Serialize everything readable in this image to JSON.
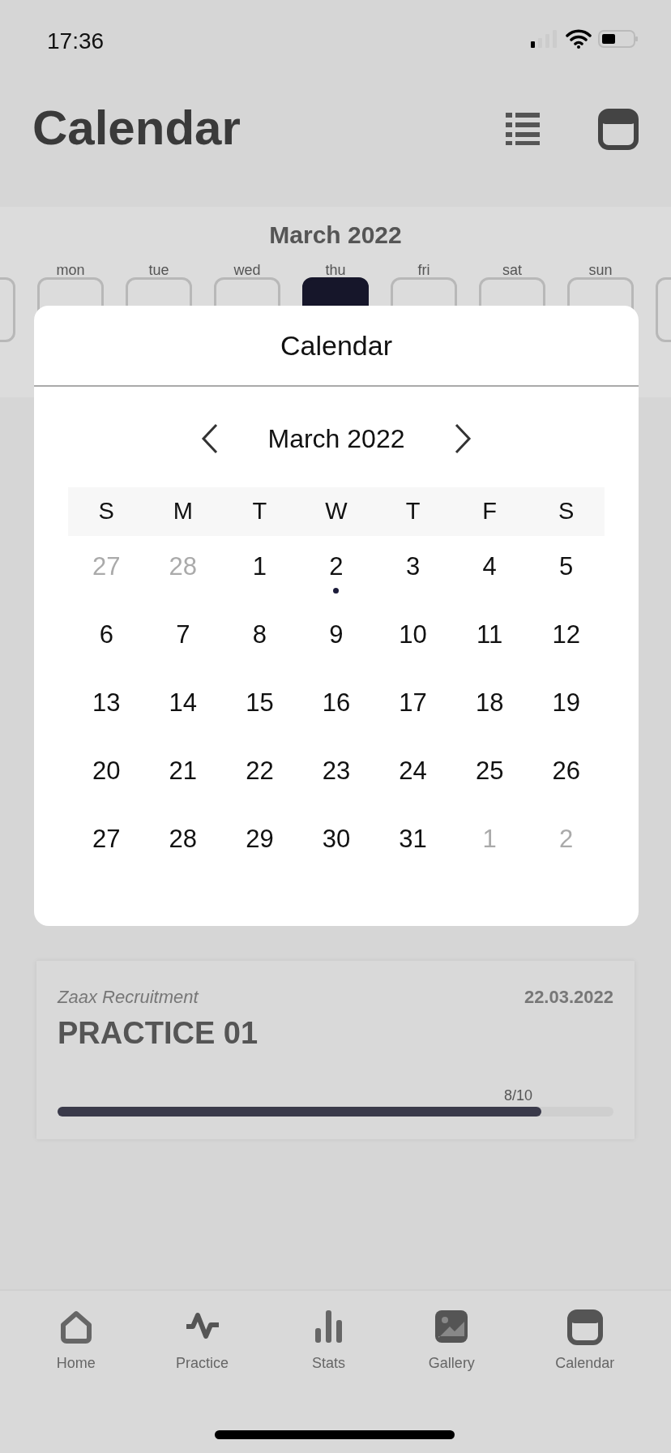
{
  "status_bar": {
    "time": "17:36"
  },
  "background": {
    "title": "Calendar",
    "month": "March 2022",
    "week_days": [
      {
        "label": "mon",
        "selected": false
      },
      {
        "label": "tue",
        "selected": false
      },
      {
        "label": "wed",
        "selected": false
      },
      {
        "label": "thu",
        "selected": true
      },
      {
        "label": "fri",
        "selected": false
      },
      {
        "label": "sat",
        "selected": false
      },
      {
        "label": "sun",
        "selected": false
      }
    ],
    "card": {
      "organizer": "Zaax Recruitment",
      "date": "22.03.2022",
      "title": "PRACTICE 01",
      "progress_text": "8/10",
      "level": 0.87
    },
    "tabs": [
      {
        "label": "Home",
        "kind": "home"
      },
      {
        "label": "Practice",
        "kind": "practice"
      },
      {
        "label": "Stats",
        "kind": "stats"
      },
      {
        "label": "Gallery",
        "kind": "gallery"
      },
      {
        "label": "Calendar",
        "kind": "calendar"
      }
    ]
  },
  "modal": {
    "title": "Calendar",
    "month": "March 2022",
    "weekdays": [
      "S",
      "M",
      "T",
      "W",
      "T",
      "F",
      "S"
    ],
    "days": [
      {
        "label": "27",
        "outside_month": true,
        "has_event": false
      },
      {
        "label": "28",
        "outside_month": true,
        "has_event": false
      },
      {
        "label": "1",
        "outside_month": false,
        "has_event": false
      },
      {
        "label": "2",
        "outside_month": false,
        "has_event": true
      },
      {
        "label": "3",
        "outside_month": false,
        "has_event": false
      },
      {
        "label": "4",
        "outside_month": false,
        "has_event": false
      },
      {
        "label": "5",
        "outside_month": false,
        "has_event": false
      },
      {
        "label": "6",
        "outside_month": false,
        "has_event": false
      },
      {
        "label": "7",
        "outside_month": false,
        "has_event": false
      },
      {
        "label": "8",
        "outside_month": false,
        "has_event": false
      },
      {
        "label": "9",
        "outside_month": false,
        "has_event": false
      },
      {
        "label": "10",
        "outside_month": false,
        "has_event": false
      },
      {
        "label": "11",
        "outside_month": false,
        "has_event": false
      },
      {
        "label": "12",
        "outside_month": false,
        "has_event": false
      },
      {
        "label": "13",
        "outside_month": false,
        "has_event": false
      },
      {
        "label": "14",
        "outside_month": false,
        "has_event": false
      },
      {
        "label": "15",
        "outside_month": false,
        "has_event": false
      },
      {
        "label": "16",
        "outside_month": false,
        "has_event": false
      },
      {
        "label": "17",
        "outside_month": false,
        "has_event": false
      },
      {
        "label": "18",
        "outside_month": false,
        "has_event": false
      },
      {
        "label": "19",
        "outside_month": false,
        "has_event": false
      },
      {
        "label": "20",
        "outside_month": false,
        "has_event": false
      },
      {
        "label": "21",
        "outside_month": false,
        "has_event": false
      },
      {
        "label": "22",
        "outside_month": false,
        "has_event": false
      },
      {
        "label": "23",
        "outside_month": false,
        "has_event": false
      },
      {
        "label": "24",
        "outside_month": false,
        "has_event": false
      },
      {
        "label": "25",
        "outside_month": false,
        "has_event": false
      },
      {
        "label": "26",
        "outside_month": false,
        "has_event": false
      },
      {
        "label": "27",
        "outside_month": false,
        "has_event": false
      },
      {
        "label": "28",
        "outside_month": false,
        "has_event": false
      },
      {
        "label": "29",
        "outside_month": false,
        "has_event": false
      },
      {
        "label": "30",
        "outside_month": false,
        "has_event": false
      },
      {
        "label": "31",
        "outside_month": false,
        "has_event": false
      },
      {
        "label": "1",
        "outside_month": true,
        "has_event": false
      },
      {
        "label": "2",
        "outside_month": true,
        "has_event": false
      }
    ]
  }
}
